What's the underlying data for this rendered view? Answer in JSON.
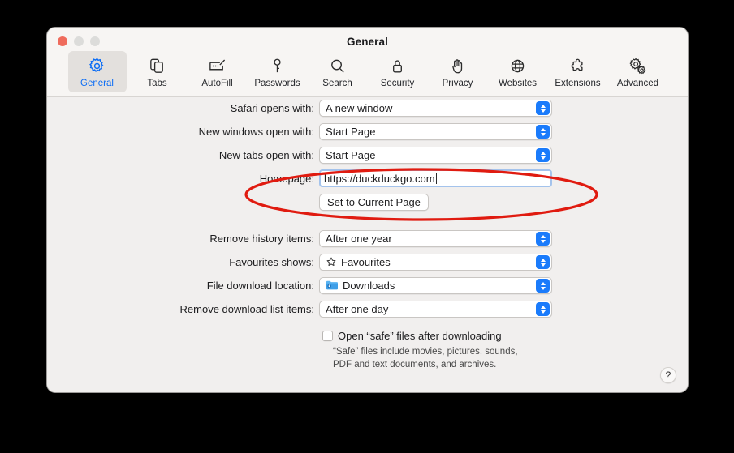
{
  "window": {
    "title": "General",
    "traffic_lights": [
      "close-button",
      "minimize-button",
      "zoom-button"
    ]
  },
  "toolbar": {
    "items": [
      {
        "label": "General",
        "icon": "gear-icon",
        "selected": true
      },
      {
        "label": "Tabs",
        "icon": "tabs-icon",
        "selected": false
      },
      {
        "label": "AutoFill",
        "icon": "autofill-icon",
        "selected": false
      },
      {
        "label": "Passwords",
        "icon": "key-icon",
        "selected": false
      },
      {
        "label": "Search",
        "icon": "magnifier-icon",
        "selected": false
      },
      {
        "label": "Security",
        "icon": "lock-icon",
        "selected": false
      },
      {
        "label": "Privacy",
        "icon": "hand-icon",
        "selected": false
      },
      {
        "label": "Websites",
        "icon": "globe-icon",
        "selected": false
      },
      {
        "label": "Extensions",
        "icon": "puzzle-icon",
        "selected": false
      },
      {
        "label": "Advanced",
        "icon": "gears-icon",
        "selected": false
      }
    ]
  },
  "form": {
    "safari_opens_with": {
      "label": "Safari opens with:",
      "value": "A new window"
    },
    "new_windows_open_with": {
      "label": "New windows open with:",
      "value": "Start Page"
    },
    "new_tabs_open_with": {
      "label": "New tabs open with:",
      "value": "Start Page"
    },
    "homepage": {
      "label": "Homepage:",
      "value": "https://duckduckgo.com",
      "placeholder": ""
    },
    "set_to_current_page": {
      "label": "Set to Current Page"
    },
    "remove_history_items": {
      "label": "Remove history items:",
      "value": "After one year"
    },
    "favourites_shows": {
      "label": "Favourites shows:",
      "value": "Favourites",
      "icon": "star-icon"
    },
    "file_download_location": {
      "label": "File download location:",
      "value": "Downloads",
      "icon": "downloads-folder-icon"
    },
    "remove_download_list_items": {
      "label": "Remove download list items:",
      "value": "After one day"
    },
    "open_safe_files": {
      "label": "Open “safe” files after downloading",
      "checked": false
    },
    "safe_files_hint": "“Safe” files include movies, pictures, sounds,\nPDF and text documents, and archives."
  },
  "help_button": {
    "glyph": "?"
  },
  "annotation": {
    "type": "ellipse",
    "color": "#e01b10",
    "targets": "homepage-row-and-set-to-current-page"
  },
  "colors": {
    "accent_blue": "#0a6cf5",
    "popup_arrow_blue": "#1a7bfb",
    "window_bg": "#f1efee",
    "titlebar_bg": "#f7f5f3",
    "annotation_red": "#e01b10",
    "close_light": "#ef6b5c"
  }
}
